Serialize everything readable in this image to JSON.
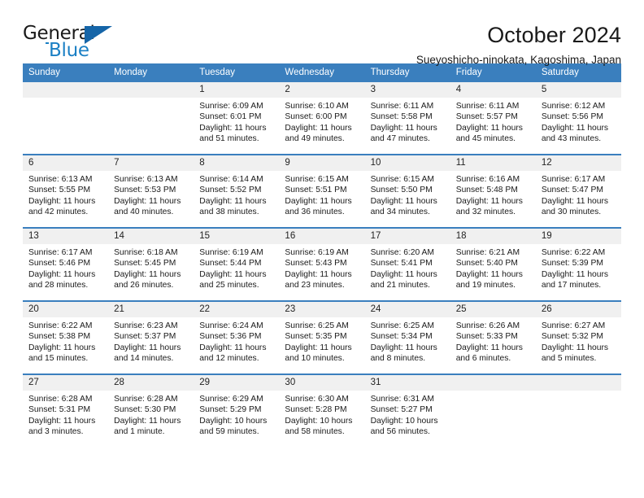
{
  "brand": {
    "name_top": "General",
    "name_bottom": "Blue",
    "accent_color": "#1a7fc4",
    "triangle_color": "#1565a8"
  },
  "header": {
    "title": "October 2024",
    "subtitle": "Sueyoshicho-ninokata, Kagoshima, Japan"
  },
  "calendar": {
    "header_bg": "#3a7fbe",
    "day_band_bg": "#f0f0f0",
    "weekdays": [
      "Sunday",
      "Monday",
      "Tuesday",
      "Wednesday",
      "Thursday",
      "Friday",
      "Saturday"
    ],
    "weeks": [
      [
        {
          "day": "",
          "empty": true
        },
        {
          "day": "",
          "empty": true
        },
        {
          "day": "1",
          "sunrise": "Sunrise: 6:09 AM",
          "sunset": "Sunset: 6:01 PM",
          "daylight_1": "Daylight: 11 hours",
          "daylight_2": "and 51 minutes."
        },
        {
          "day": "2",
          "sunrise": "Sunrise: 6:10 AM",
          "sunset": "Sunset: 6:00 PM",
          "daylight_1": "Daylight: 11 hours",
          "daylight_2": "and 49 minutes."
        },
        {
          "day": "3",
          "sunrise": "Sunrise: 6:11 AM",
          "sunset": "Sunset: 5:58 PM",
          "daylight_1": "Daylight: 11 hours",
          "daylight_2": "and 47 minutes."
        },
        {
          "day": "4",
          "sunrise": "Sunrise: 6:11 AM",
          "sunset": "Sunset: 5:57 PM",
          "daylight_1": "Daylight: 11 hours",
          "daylight_2": "and 45 minutes."
        },
        {
          "day": "5",
          "sunrise": "Sunrise: 6:12 AM",
          "sunset": "Sunset: 5:56 PM",
          "daylight_1": "Daylight: 11 hours",
          "daylight_2": "and 43 minutes."
        }
      ],
      [
        {
          "day": "6",
          "sunrise": "Sunrise: 6:13 AM",
          "sunset": "Sunset: 5:55 PM",
          "daylight_1": "Daylight: 11 hours",
          "daylight_2": "and 42 minutes."
        },
        {
          "day": "7",
          "sunrise": "Sunrise: 6:13 AM",
          "sunset": "Sunset: 5:53 PM",
          "daylight_1": "Daylight: 11 hours",
          "daylight_2": "and 40 minutes."
        },
        {
          "day": "8",
          "sunrise": "Sunrise: 6:14 AM",
          "sunset": "Sunset: 5:52 PM",
          "daylight_1": "Daylight: 11 hours",
          "daylight_2": "and 38 minutes."
        },
        {
          "day": "9",
          "sunrise": "Sunrise: 6:15 AM",
          "sunset": "Sunset: 5:51 PM",
          "daylight_1": "Daylight: 11 hours",
          "daylight_2": "and 36 minutes."
        },
        {
          "day": "10",
          "sunrise": "Sunrise: 6:15 AM",
          "sunset": "Sunset: 5:50 PM",
          "daylight_1": "Daylight: 11 hours",
          "daylight_2": "and 34 minutes."
        },
        {
          "day": "11",
          "sunrise": "Sunrise: 6:16 AM",
          "sunset": "Sunset: 5:48 PM",
          "daylight_1": "Daylight: 11 hours",
          "daylight_2": "and 32 minutes."
        },
        {
          "day": "12",
          "sunrise": "Sunrise: 6:17 AM",
          "sunset": "Sunset: 5:47 PM",
          "daylight_1": "Daylight: 11 hours",
          "daylight_2": "and 30 minutes."
        }
      ],
      [
        {
          "day": "13",
          "sunrise": "Sunrise: 6:17 AM",
          "sunset": "Sunset: 5:46 PM",
          "daylight_1": "Daylight: 11 hours",
          "daylight_2": "and 28 minutes."
        },
        {
          "day": "14",
          "sunrise": "Sunrise: 6:18 AM",
          "sunset": "Sunset: 5:45 PM",
          "daylight_1": "Daylight: 11 hours",
          "daylight_2": "and 26 minutes."
        },
        {
          "day": "15",
          "sunrise": "Sunrise: 6:19 AM",
          "sunset": "Sunset: 5:44 PM",
          "daylight_1": "Daylight: 11 hours",
          "daylight_2": "and 25 minutes."
        },
        {
          "day": "16",
          "sunrise": "Sunrise: 6:19 AM",
          "sunset": "Sunset: 5:43 PM",
          "daylight_1": "Daylight: 11 hours",
          "daylight_2": "and 23 minutes."
        },
        {
          "day": "17",
          "sunrise": "Sunrise: 6:20 AM",
          "sunset": "Sunset: 5:41 PM",
          "daylight_1": "Daylight: 11 hours",
          "daylight_2": "and 21 minutes."
        },
        {
          "day": "18",
          "sunrise": "Sunrise: 6:21 AM",
          "sunset": "Sunset: 5:40 PM",
          "daylight_1": "Daylight: 11 hours",
          "daylight_2": "and 19 minutes."
        },
        {
          "day": "19",
          "sunrise": "Sunrise: 6:22 AM",
          "sunset": "Sunset: 5:39 PM",
          "daylight_1": "Daylight: 11 hours",
          "daylight_2": "and 17 minutes."
        }
      ],
      [
        {
          "day": "20",
          "sunrise": "Sunrise: 6:22 AM",
          "sunset": "Sunset: 5:38 PM",
          "daylight_1": "Daylight: 11 hours",
          "daylight_2": "and 15 minutes."
        },
        {
          "day": "21",
          "sunrise": "Sunrise: 6:23 AM",
          "sunset": "Sunset: 5:37 PM",
          "daylight_1": "Daylight: 11 hours",
          "daylight_2": "and 14 minutes."
        },
        {
          "day": "22",
          "sunrise": "Sunrise: 6:24 AM",
          "sunset": "Sunset: 5:36 PM",
          "daylight_1": "Daylight: 11 hours",
          "daylight_2": "and 12 minutes."
        },
        {
          "day": "23",
          "sunrise": "Sunrise: 6:25 AM",
          "sunset": "Sunset: 5:35 PM",
          "daylight_1": "Daylight: 11 hours",
          "daylight_2": "and 10 minutes."
        },
        {
          "day": "24",
          "sunrise": "Sunrise: 6:25 AM",
          "sunset": "Sunset: 5:34 PM",
          "daylight_1": "Daylight: 11 hours",
          "daylight_2": "and 8 minutes."
        },
        {
          "day": "25",
          "sunrise": "Sunrise: 6:26 AM",
          "sunset": "Sunset: 5:33 PM",
          "daylight_1": "Daylight: 11 hours",
          "daylight_2": "and 6 minutes."
        },
        {
          "day": "26",
          "sunrise": "Sunrise: 6:27 AM",
          "sunset": "Sunset: 5:32 PM",
          "daylight_1": "Daylight: 11 hours",
          "daylight_2": "and 5 minutes."
        }
      ],
      [
        {
          "day": "27",
          "sunrise": "Sunrise: 6:28 AM",
          "sunset": "Sunset: 5:31 PM",
          "daylight_1": "Daylight: 11 hours",
          "daylight_2": "and 3 minutes."
        },
        {
          "day": "28",
          "sunrise": "Sunrise: 6:28 AM",
          "sunset": "Sunset: 5:30 PM",
          "daylight_1": "Daylight: 11 hours",
          "daylight_2": "and 1 minute."
        },
        {
          "day": "29",
          "sunrise": "Sunrise: 6:29 AM",
          "sunset": "Sunset: 5:29 PM",
          "daylight_1": "Daylight: 10 hours",
          "daylight_2": "and 59 minutes."
        },
        {
          "day": "30",
          "sunrise": "Sunrise: 6:30 AM",
          "sunset": "Sunset: 5:28 PM",
          "daylight_1": "Daylight: 10 hours",
          "daylight_2": "and 58 minutes."
        },
        {
          "day": "31",
          "sunrise": "Sunrise: 6:31 AM",
          "sunset": "Sunset: 5:27 PM",
          "daylight_1": "Daylight: 10 hours",
          "daylight_2": "and 56 minutes."
        },
        {
          "day": "",
          "empty": true
        },
        {
          "day": "",
          "empty": true
        }
      ]
    ]
  }
}
